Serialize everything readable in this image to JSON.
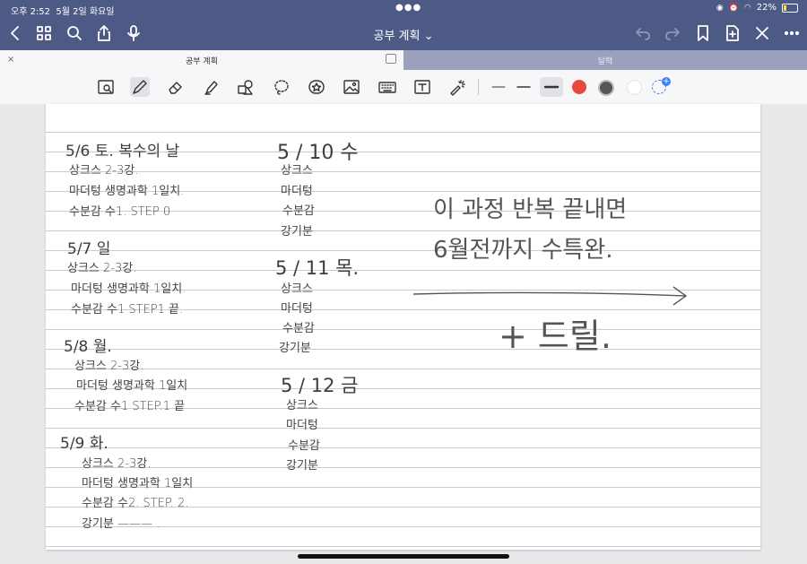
{
  "status_bar": {
    "time": "오후 2:52",
    "date": "5월 2일 화요일",
    "battery": "22%",
    "battery_level": 0.22
  },
  "header": {
    "title": "공부 계획 ⌄"
  },
  "tabs": [
    {
      "label": "공부 계획",
      "active": true
    },
    {
      "label": "달력",
      "active": false
    }
  ],
  "toolbar": {
    "tools": [
      "lasso-ocr-icon",
      "pen-icon",
      "eraser-icon",
      "highlighter-icon",
      "shapes-icon",
      "lasso-icon",
      "sticker-icon",
      "image-icon",
      "keyboard-icon",
      "text-icon",
      "laser-pointer-icon"
    ],
    "colors": {
      "red": "#e8483f",
      "dark": "#555555",
      "white": "#ffffff",
      "accent": "#3b82f6"
    }
  },
  "notes": {
    "col1": [
      "5/6 토. 복수의 날",
      "상크스 2-3강.",
      "마더텅 생명과학 1일치.",
      "수분감 수1. STEP 0",
      "5/7 일",
      "상크스 2-3강.",
      "마더텅 생명과학 1일치.",
      "수분감 수1 STEP1 끝.",
      "5/8 월.",
      "상크스 2-3강.",
      "마더텅 생명과학 1일치",
      "수분감 수1 STEP.1 끝",
      "5/9 화.",
      "상크스 2-3강.",
      "마더텅 생명과학 1일치",
      "수분감 수2. STEP. 2.",
      "강기분 ———  ."
    ],
    "col2": [
      "5 / 10 수",
      "상크스",
      "마더텅",
      "수분감",
      "강기분",
      "5 / 11 목.",
      "상크스",
      "마더텅",
      "수분감",
      "강기분",
      "5 / 12 금",
      "상크스",
      "마더텅",
      "수분감",
      "강기분"
    ],
    "right": [
      "이 과정 반복 끝내면",
      "6월전까지 수특완.",
      "+ 드릴."
    ]
  }
}
